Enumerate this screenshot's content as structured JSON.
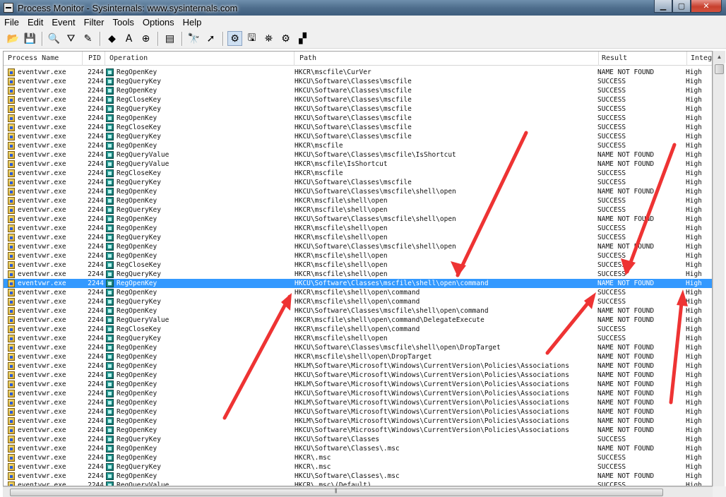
{
  "window": {
    "title": "Process Monitor - Sysinternals: www.sysinternals.com",
    "controls": {
      "minimize": "▁",
      "maximize": "▢",
      "close": "✕"
    }
  },
  "menu": [
    "File",
    "Edit",
    "Event",
    "Filter",
    "Tools",
    "Options",
    "Help"
  ],
  "toolbar": [
    {
      "name": "open-icon",
      "glyph": "📂"
    },
    {
      "name": "save-icon",
      "glyph": "💾"
    },
    {
      "sep": true
    },
    {
      "name": "magnify-icon",
      "glyph": "🔍"
    },
    {
      "name": "filter-icon",
      "glyph": "⛛"
    },
    {
      "name": "edit-filter-icon",
      "glyph": "✎"
    },
    {
      "sep": true
    },
    {
      "name": "highlight-icon",
      "glyph": "◆"
    },
    {
      "name": "include-icon",
      "glyph": "A"
    },
    {
      "name": "target-icon",
      "glyph": "⊕"
    },
    {
      "sep": true
    },
    {
      "name": "properties-icon",
      "glyph": "▤"
    },
    {
      "sep": true
    },
    {
      "name": "find-icon",
      "glyph": "🔭"
    },
    {
      "name": "jump-icon",
      "glyph": "➚"
    },
    {
      "sep": true
    },
    {
      "name": "registry-activity-icon",
      "glyph": "⚙",
      "pressed": true
    },
    {
      "name": "filesystem-activity-icon",
      "glyph": "🖫"
    },
    {
      "name": "network-activity-icon",
      "glyph": "⛯"
    },
    {
      "name": "process-activity-icon",
      "glyph": "⚙"
    },
    {
      "name": "profiling-activity-icon",
      "glyph": "▞"
    }
  ],
  "columns": [
    "Process Name",
    "PID",
    "Operation",
    "Path",
    "Result",
    "Integ"
  ],
  "selected_row_index": 23,
  "rows": [
    {
      "proc": "eventvwr.exe",
      "pid": "2244",
      "op": "RegOpenKey",
      "path": "HKCR\\mscfile\\CurVer",
      "result": "NAME NOT FOUND",
      "integ": "High"
    },
    {
      "proc": "eventvwr.exe",
      "pid": "2244",
      "op": "RegQueryKey",
      "path": "HKCU\\Software\\Classes\\mscfile",
      "result": "SUCCESS",
      "integ": "High"
    },
    {
      "proc": "eventvwr.exe",
      "pid": "2244",
      "op": "RegOpenKey",
      "path": "HKCU\\Software\\Classes\\mscfile",
      "result": "SUCCESS",
      "integ": "High"
    },
    {
      "proc": "eventvwr.exe",
      "pid": "2244",
      "op": "RegCloseKey",
      "path": "HKCU\\Software\\Classes\\mscfile",
      "result": "SUCCESS",
      "integ": "High"
    },
    {
      "proc": "eventvwr.exe",
      "pid": "2244",
      "op": "RegQueryKey",
      "path": "HKCU\\Software\\Classes\\mscfile",
      "result": "SUCCESS",
      "integ": "High"
    },
    {
      "proc": "eventvwr.exe",
      "pid": "2244",
      "op": "RegOpenKey",
      "path": "HKCU\\Software\\Classes\\mscfile",
      "result": "SUCCESS",
      "integ": "High"
    },
    {
      "proc": "eventvwr.exe",
      "pid": "2244",
      "op": "RegCloseKey",
      "path": "HKCU\\Software\\Classes\\mscfile",
      "result": "SUCCESS",
      "integ": "High"
    },
    {
      "proc": "eventvwr.exe",
      "pid": "2244",
      "op": "RegQueryKey",
      "path": "HKCU\\Software\\Classes\\mscfile",
      "result": "SUCCESS",
      "integ": "High"
    },
    {
      "proc": "eventvwr.exe",
      "pid": "2244",
      "op": "RegOpenKey",
      "path": "HKCR\\mscfile",
      "result": "SUCCESS",
      "integ": "High"
    },
    {
      "proc": "eventvwr.exe",
      "pid": "2244",
      "op": "RegQueryValue",
      "path": "HKCU\\Software\\Classes\\mscfile\\IsShortcut",
      "result": "NAME NOT FOUND",
      "integ": "High"
    },
    {
      "proc": "eventvwr.exe",
      "pid": "2244",
      "op": "RegQueryValue",
      "path": "HKCR\\mscfile\\IsShortcut",
      "result": "NAME NOT FOUND",
      "integ": "High"
    },
    {
      "proc": "eventvwr.exe",
      "pid": "2244",
      "op": "RegCloseKey",
      "path": "HKCR\\mscfile",
      "result": "SUCCESS",
      "integ": "High"
    },
    {
      "proc": "eventvwr.exe",
      "pid": "2244",
      "op": "RegQueryKey",
      "path": "HKCU\\Software\\Classes\\mscfile",
      "result": "SUCCESS",
      "integ": "High"
    },
    {
      "proc": "eventvwr.exe",
      "pid": "2244",
      "op": "RegOpenKey",
      "path": "HKCU\\Software\\Classes\\mscfile\\shell\\open",
      "result": "NAME NOT FOUND",
      "integ": "High"
    },
    {
      "proc": "eventvwr.exe",
      "pid": "2244",
      "op": "RegOpenKey",
      "path": "HKCR\\mscfile\\shell\\open",
      "result": "SUCCESS",
      "integ": "High"
    },
    {
      "proc": "eventvwr.exe",
      "pid": "2244",
      "op": "RegQueryKey",
      "path": "HKCR\\mscfile\\shell\\open",
      "result": "SUCCESS",
      "integ": "High"
    },
    {
      "proc": "eventvwr.exe",
      "pid": "2244",
      "op": "RegOpenKey",
      "path": "HKCU\\Software\\Classes\\mscfile\\shell\\open",
      "result": "NAME NOT FOUND",
      "integ": "High"
    },
    {
      "proc": "eventvwr.exe",
      "pid": "2244",
      "op": "RegOpenKey",
      "path": "HKCR\\mscfile\\shell\\open",
      "result": "SUCCESS",
      "integ": "High"
    },
    {
      "proc": "eventvwr.exe",
      "pid": "2244",
      "op": "RegQueryKey",
      "path": "HKCR\\mscfile\\shell\\open",
      "result": "SUCCESS",
      "integ": "High"
    },
    {
      "proc": "eventvwr.exe",
      "pid": "2244",
      "op": "RegOpenKey",
      "path": "HKCU\\Software\\Classes\\mscfile\\shell\\open",
      "result": "NAME NOT FOUND",
      "integ": "High"
    },
    {
      "proc": "eventvwr.exe",
      "pid": "2244",
      "op": "RegOpenKey",
      "path": "HKCR\\mscfile\\shell\\open",
      "result": "SUCCESS",
      "integ": "High"
    },
    {
      "proc": "eventvwr.exe",
      "pid": "2244",
      "op": "RegCloseKey",
      "path": "HKCR\\mscfile\\shell\\open",
      "result": "SUCCESS",
      "integ": "High"
    },
    {
      "proc": "eventvwr.exe",
      "pid": "2244",
      "op": "RegQueryKey",
      "path": "HKCR\\mscfile\\shell\\open",
      "result": "SUCCESS",
      "integ": "High"
    },
    {
      "proc": "eventvwr.exe",
      "pid": "2244",
      "op": "RegOpenKey",
      "path": "HKCU\\Software\\Classes\\mscfile\\shell\\open\\command",
      "result": "NAME NOT FOUND",
      "integ": "High"
    },
    {
      "proc": "eventvwr.exe",
      "pid": "2244",
      "op": "RegOpenKey",
      "path": "HKCR\\mscfile\\shell\\open\\command",
      "result": "SUCCESS",
      "integ": "High"
    },
    {
      "proc": "eventvwr.exe",
      "pid": "2244",
      "op": "RegQueryKey",
      "path": "HKCR\\mscfile\\shell\\open\\command",
      "result": "SUCCESS",
      "integ": "High"
    },
    {
      "proc": "eventvwr.exe",
      "pid": "2244",
      "op": "RegOpenKey",
      "path": "HKCU\\Software\\Classes\\mscfile\\shell\\open\\command",
      "result": "NAME NOT FOUND",
      "integ": "High"
    },
    {
      "proc": "eventvwr.exe",
      "pid": "2244",
      "op": "RegQueryValue",
      "path": "HKCR\\mscfile\\shell\\open\\command\\DelegateExecute",
      "result": "NAME NOT FOUND",
      "integ": "High"
    },
    {
      "proc": "eventvwr.exe",
      "pid": "2244",
      "op": "RegCloseKey",
      "path": "HKCR\\mscfile\\shell\\open\\command",
      "result": "SUCCESS",
      "integ": "High"
    },
    {
      "proc": "eventvwr.exe",
      "pid": "2244",
      "op": "RegQueryKey",
      "path": "HKCR\\mscfile\\shell\\open",
      "result": "SUCCESS",
      "integ": "High"
    },
    {
      "proc": "eventvwr.exe",
      "pid": "2244",
      "op": "RegOpenKey",
      "path": "HKCU\\Software\\Classes\\mscfile\\shell\\open\\DropTarget",
      "result": "NAME NOT FOUND",
      "integ": "High"
    },
    {
      "proc": "eventvwr.exe",
      "pid": "2244",
      "op": "RegOpenKey",
      "path": "HKCR\\mscfile\\shell\\open\\DropTarget",
      "result": "NAME NOT FOUND",
      "integ": "High"
    },
    {
      "proc": "eventvwr.exe",
      "pid": "2244",
      "op": "RegOpenKey",
      "path": "HKLM\\Software\\Microsoft\\Windows\\CurrentVersion\\Policies\\Associations",
      "result": "NAME NOT FOUND",
      "integ": "High"
    },
    {
      "proc": "eventvwr.exe",
      "pid": "2244",
      "op": "RegOpenKey",
      "path": "HKCU\\Software\\Microsoft\\Windows\\CurrentVersion\\Policies\\Associations",
      "result": "NAME NOT FOUND",
      "integ": "High"
    },
    {
      "proc": "eventvwr.exe",
      "pid": "2244",
      "op": "RegOpenKey",
      "path": "HKLM\\Software\\Microsoft\\Windows\\CurrentVersion\\Policies\\Associations",
      "result": "NAME NOT FOUND",
      "integ": "High"
    },
    {
      "proc": "eventvwr.exe",
      "pid": "2244",
      "op": "RegOpenKey",
      "path": "HKCU\\Software\\Microsoft\\Windows\\CurrentVersion\\Policies\\Associations",
      "result": "NAME NOT FOUND",
      "integ": "High"
    },
    {
      "proc": "eventvwr.exe",
      "pid": "2244",
      "op": "RegOpenKey",
      "path": "HKLM\\Software\\Microsoft\\Windows\\CurrentVersion\\Policies\\Associations",
      "result": "NAME NOT FOUND",
      "integ": "High"
    },
    {
      "proc": "eventvwr.exe",
      "pid": "2244",
      "op": "RegOpenKey",
      "path": "HKCU\\Software\\Microsoft\\Windows\\CurrentVersion\\Policies\\Associations",
      "result": "NAME NOT FOUND",
      "integ": "High"
    },
    {
      "proc": "eventvwr.exe",
      "pid": "2244",
      "op": "RegOpenKey",
      "path": "HKLM\\Software\\Microsoft\\Windows\\CurrentVersion\\Policies\\Associations",
      "result": "NAME NOT FOUND",
      "integ": "High"
    },
    {
      "proc": "eventvwr.exe",
      "pid": "2244",
      "op": "RegOpenKey",
      "path": "HKCU\\Software\\Microsoft\\Windows\\CurrentVersion\\Policies\\Associations",
      "result": "NAME NOT FOUND",
      "integ": "High"
    },
    {
      "proc": "eventvwr.exe",
      "pid": "2244",
      "op": "RegQueryKey",
      "path": "HKCU\\Software\\Classes",
      "result": "SUCCESS",
      "integ": "High"
    },
    {
      "proc": "eventvwr.exe",
      "pid": "2244",
      "op": "RegOpenKey",
      "path": "HKCU\\Software\\Classes\\.msc",
      "result": "NAME NOT FOUND",
      "integ": "High"
    },
    {
      "proc": "eventvwr.exe",
      "pid": "2244",
      "op": "RegOpenKey",
      "path": "HKCR\\.msc",
      "result": "SUCCESS",
      "integ": "High"
    },
    {
      "proc": "eventvwr.exe",
      "pid": "2244",
      "op": "RegQueryKey",
      "path": "HKCR\\.msc",
      "result": "SUCCESS",
      "integ": "High"
    },
    {
      "proc": "eventvwr.exe",
      "pid": "2244",
      "op": "RegOpenKey",
      "path": "HKCU\\Software\\Classes\\.msc",
      "result": "NAME NOT FOUND",
      "integ": "High"
    },
    {
      "proc": "eventvwr.exe",
      "pid": "2244",
      "op": "RegQueryValue",
      "path": "HKCR\\.msc\\(Default)",
      "result": "SUCCESS",
      "integ": "High"
    }
  ],
  "colors": {
    "selection": "#3399ff",
    "annotation_arrow": "#ee3333"
  }
}
